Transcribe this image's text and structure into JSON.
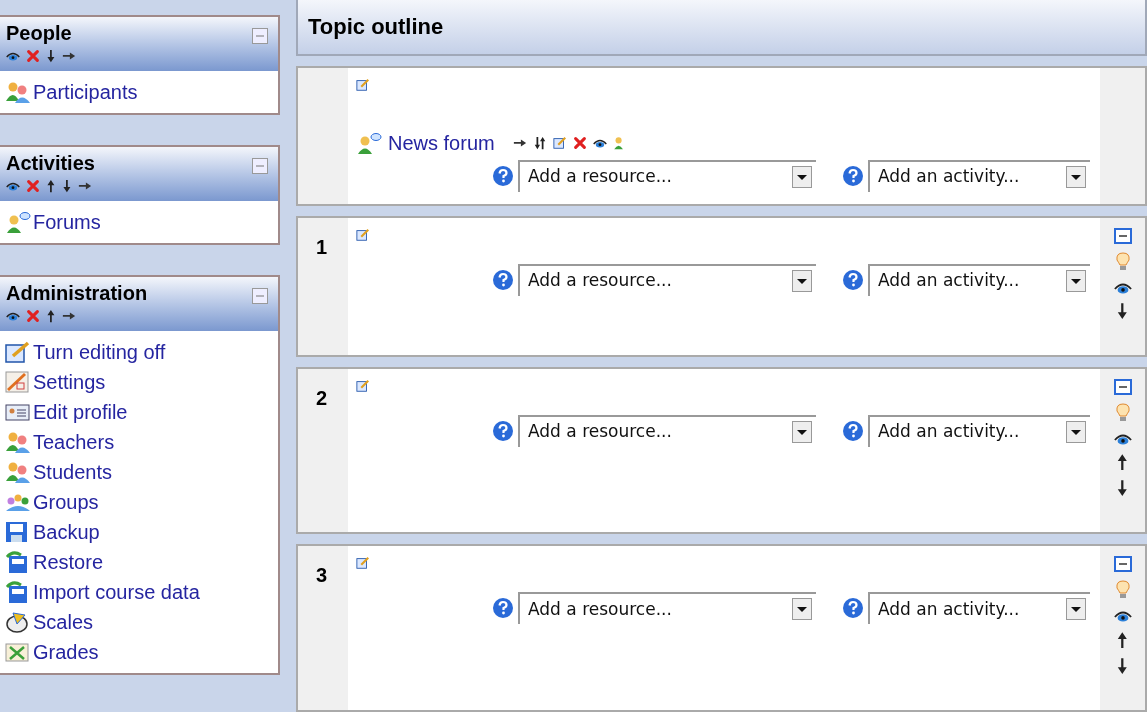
{
  "blocks": [
    {
      "title": "People",
      "items": [
        "Participants"
      ]
    },
    {
      "title": "Activities",
      "items": [
        "Forums"
      ]
    },
    {
      "title": "Administration",
      "items": [
        "Turn editing off",
        "Settings",
        "Edit profile",
        "Teachers",
        "Students",
        "Groups",
        "Backup",
        "Restore",
        "Import course data",
        "Scales",
        "Grades"
      ]
    }
  ],
  "main": {
    "title": "Topic outline",
    "sections": [
      {
        "activities": [
          "News forum"
        ],
        "resource_select": "Add a resource...",
        "activity_select": "Add an activity..."
      },
      {
        "number": "1",
        "resource_select": "Add a resource...",
        "activity_select": "Add an activity..."
      },
      {
        "number": "2",
        "resource_select": "Add a resource...",
        "activity_select": "Add an activity..."
      },
      {
        "number": "3",
        "resource_select": "Add a resource...",
        "activity_select": "Add an activity..."
      }
    ]
  }
}
